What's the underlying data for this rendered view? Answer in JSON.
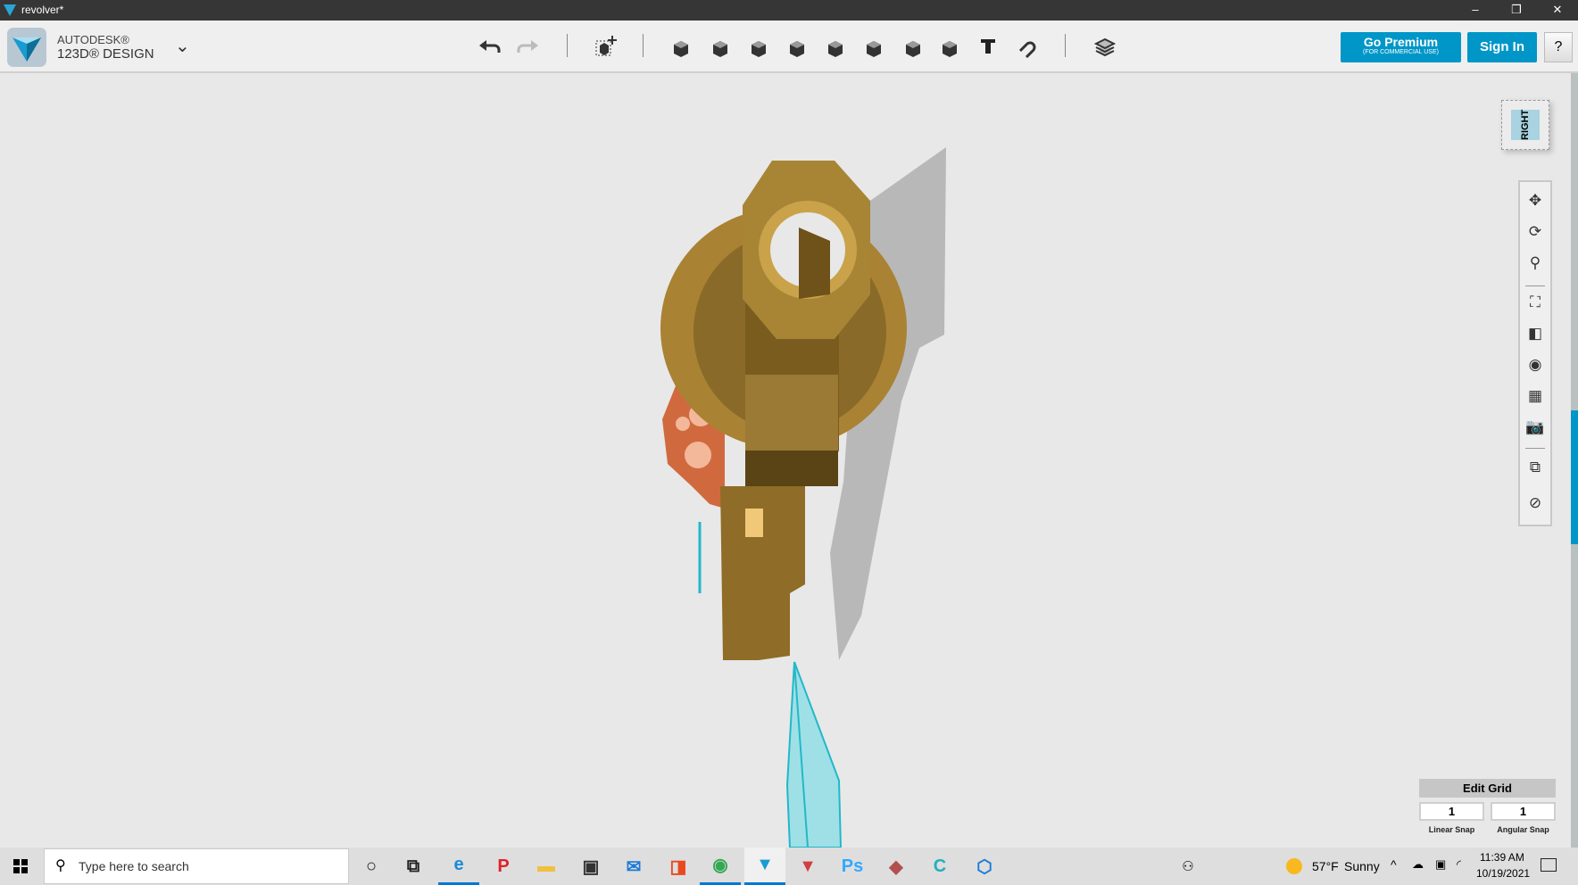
{
  "window": {
    "title": "revolver*",
    "minimize": "–",
    "maximize": "❐",
    "close": "✕"
  },
  "app": {
    "brand_line1": "AUTODESK®",
    "brand_line2": "123D® DESIGN",
    "menu_chevron": "⌄"
  },
  "toolbar": {
    "premium_label": "Go Premium",
    "premium_sub": "(FOR COMMERCIAL USE)",
    "signin_label": "Sign In",
    "help_label": "?",
    "tools": [
      "undo-icon",
      "redo-icon",
      "transform-icon",
      "primitives-icon",
      "sketch-icon",
      "construct-icon",
      "modify-icon",
      "pattern-icon",
      "group-icon",
      "combine-icon",
      "measure-icon",
      "text-icon",
      "snap-icon",
      "materials-icon"
    ]
  },
  "viewcube": {
    "face": "RIGHT"
  },
  "nav_tools": [
    "pan-icon",
    "orbit-icon",
    "zoom-icon",
    "fit-icon",
    "views-icon",
    "visibility-icon",
    "grid-toggle-icon",
    "camera-icon",
    "snap-material-icon",
    "hide-sketch-icon"
  ],
  "grid": {
    "title": "Edit Grid",
    "linear_value": "1",
    "angular_value": "1",
    "linear_label": "Linear Snap",
    "angular_label": "Angular Snap"
  },
  "taskbar": {
    "search_placeholder": "Type here to search",
    "weather_temp": "57°F",
    "weather_text": "Sunny",
    "time": "11:39 AM",
    "date": "10/19/2021"
  },
  "colors": {
    "accent": "#0096c8",
    "gold": "#b08a3a",
    "orange": "#d0693f",
    "cyan": "#22b8c8"
  }
}
